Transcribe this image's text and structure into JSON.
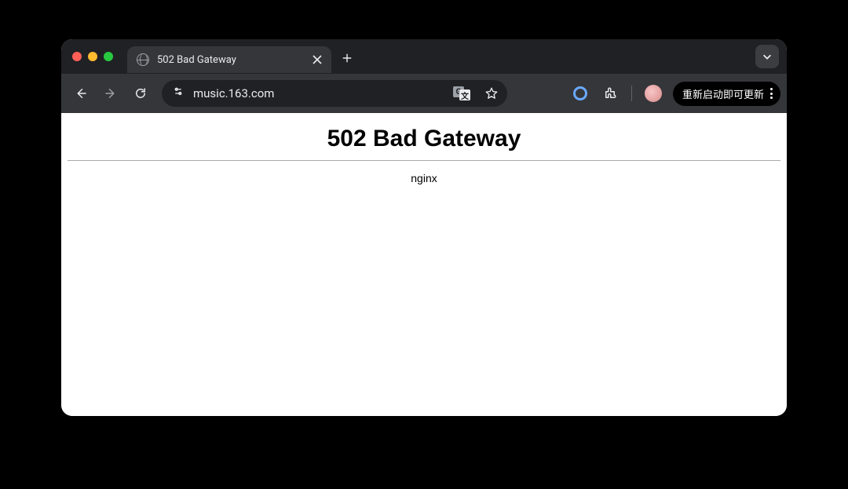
{
  "tab": {
    "title": "502 Bad Gateway"
  },
  "toolbar": {
    "url": "music.163.com",
    "update_label": "重新启动即可更新"
  },
  "page": {
    "heading": "502 Bad Gateway",
    "server": "nginx"
  }
}
